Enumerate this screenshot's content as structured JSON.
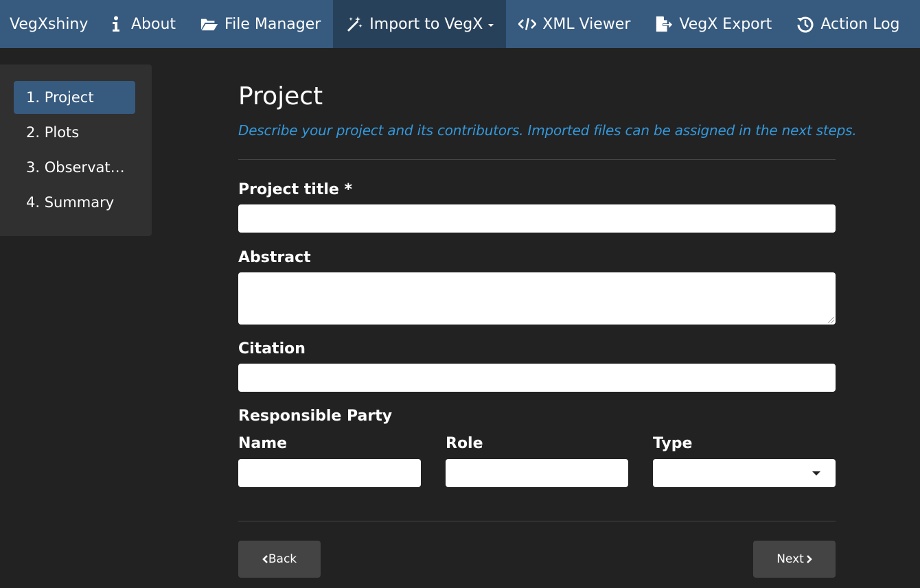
{
  "navbar": {
    "brand": "VegXshiny",
    "items": [
      {
        "label": "About",
        "icon": "info-icon"
      },
      {
        "label": "File Manager",
        "icon": "folder-open-icon"
      },
      {
        "label": "Import to VegX",
        "icon": "magic-wand-icon",
        "active": true,
        "dropdown": true
      },
      {
        "label": "XML Viewer",
        "icon": "code-icon"
      },
      {
        "label": "VegX Export",
        "icon": "file-export-icon"
      },
      {
        "label": "Action Log",
        "icon": "history-icon"
      }
    ]
  },
  "sidebar": {
    "items": [
      {
        "label": "1. Project",
        "active": true
      },
      {
        "label": "2. Plots"
      },
      {
        "label": "3. Observat…"
      },
      {
        "label": "4. Summary"
      }
    ]
  },
  "main": {
    "title": "Project",
    "subtitle": "Describe your project and its contributors. Imported files can be assigned in the next steps.",
    "fields": {
      "project_title": {
        "label": "Project title *",
        "value": ""
      },
      "abstract": {
        "label": "Abstract",
        "value": ""
      },
      "citation": {
        "label": "Citation",
        "value": ""
      }
    },
    "responsible_party": {
      "heading": "Responsible Party",
      "name_label": "Name",
      "role_label": "Role",
      "type_label": "Type",
      "type_selected": ""
    },
    "buttons": {
      "back": "Back",
      "next": "Next"
    }
  },
  "colors": {
    "navbar_bg": "#375a7f",
    "navbar_active": "#28415b",
    "page_bg": "#222222",
    "sidebar_bg": "#303030",
    "accent": "#3498db",
    "button_bg": "#444444"
  }
}
